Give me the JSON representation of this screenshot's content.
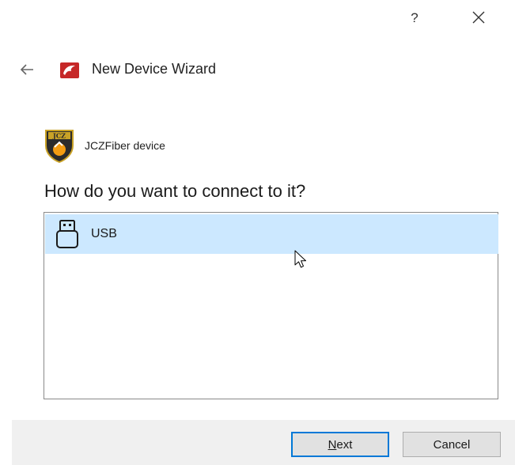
{
  "window": {
    "help_label": "?",
    "close_icon": "close-icon"
  },
  "header": {
    "back_icon": "arrow-left-icon",
    "title": "New Device Wizard",
    "wizard_icon": "wizard-logo-icon"
  },
  "device": {
    "name": "JCZFiber device",
    "icon": "jcz-logo-icon"
  },
  "prompt": {
    "question": "How do you want to connect to it?"
  },
  "connections": {
    "items": [
      {
        "label": "USB",
        "icon": "usb-icon",
        "selected": true
      }
    ]
  },
  "footer": {
    "next_mnemonic": "N",
    "next_rest": "ext",
    "cancel_label": "Cancel"
  },
  "colors": {
    "selection": "#cce8ff",
    "default_button_border": "#0078d7",
    "footer_bg": "#f0f0f0"
  }
}
